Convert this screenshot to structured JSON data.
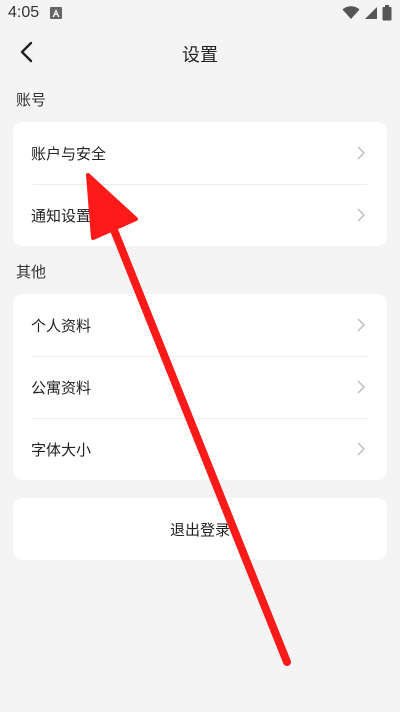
{
  "status_bar": {
    "time": "4:05",
    "icons": [
      "app-notification-icon",
      "wifi-icon",
      "signal-icon",
      "battery-icon"
    ]
  },
  "header": {
    "title": "设置",
    "back_icon": "chevron-left-icon"
  },
  "sections": [
    {
      "title": "账号",
      "items": [
        {
          "label": "账户与安全"
        },
        {
          "label": "通知设置"
        }
      ]
    },
    {
      "title": "其他",
      "items": [
        {
          "label": "个人资料"
        },
        {
          "label": "公寓资料"
        },
        {
          "label": "字体大小"
        }
      ]
    }
  ],
  "logout": {
    "label": "退出登录"
  },
  "colors": {
    "background": "#f4f4f4",
    "card": "#ffffff",
    "arrow": "#ff1a1a"
  }
}
